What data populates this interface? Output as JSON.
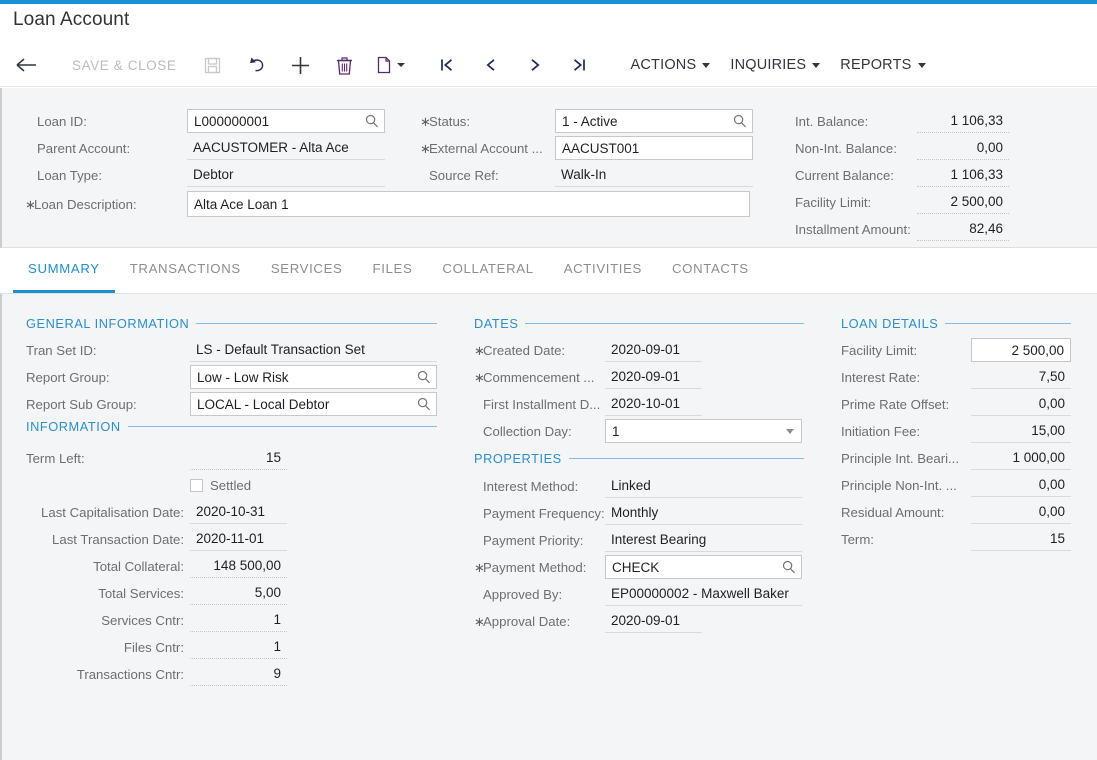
{
  "window": {
    "title": "Loan Account",
    "accent_color": "#1b90d4"
  },
  "toolbar": {
    "back_icon": "back-arrow-icon",
    "save_close_label": "SAVE & CLOSE",
    "save_icon": "save-icon",
    "undo_icon": "undo-icon",
    "add_icon": "plus-icon",
    "delete_icon": "trash-icon",
    "copy_icon": "copy-paste-icon",
    "first_icon": "first-record-icon",
    "prev_icon": "previous-record-icon",
    "next_icon": "next-record-icon",
    "last_icon": "last-record-icon",
    "menus": [
      {
        "label": "ACTIONS"
      },
      {
        "label": "INQUIRIES"
      },
      {
        "label": "REPORTS"
      }
    ]
  },
  "header": {
    "left_fields": [
      {
        "label": "Loan ID:",
        "value": "L000000001",
        "required": false,
        "style": "input",
        "lookup": true
      },
      {
        "label": "Parent Account:",
        "value": "AACUSTOMER - Alta Ace",
        "required": false,
        "style": "readonly",
        "lookup": false
      },
      {
        "label": "Loan Type:",
        "value": "Debtor",
        "required": false,
        "style": "readonly",
        "lookup": false
      }
    ],
    "description_field": {
      "label": "Loan Description:",
      "value": "Alta Ace Loan 1",
      "required": true
    },
    "mid_fields": [
      {
        "label": "Status:",
        "value": "1 - Active",
        "required": true,
        "style": "input",
        "lookup": true
      },
      {
        "label": "External Account ...",
        "value": "AACUST001",
        "required": true,
        "style": "input",
        "lookup": false
      },
      {
        "label": "Source Ref:",
        "value": "Walk-In",
        "required": false,
        "style": "readonly",
        "lookup": false
      }
    ],
    "balances": [
      {
        "label": "Int. Balance:",
        "value": "1 106,33"
      },
      {
        "label": "Non-Int. Balance:",
        "value": "0,00"
      },
      {
        "label": "Current Balance:",
        "value": "1 106,33"
      },
      {
        "label": "Facility Limit:",
        "value": "2 500,00"
      },
      {
        "label": "Installment Amount:",
        "value": "82,46"
      }
    ]
  },
  "tabs": [
    {
      "label": "SUMMARY",
      "active": true
    },
    {
      "label": "TRANSACTIONS",
      "active": false
    },
    {
      "label": "SERVICES",
      "active": false
    },
    {
      "label": "FILES",
      "active": false
    },
    {
      "label": "COLLATERAL",
      "active": false
    },
    {
      "label": "ACTIVITIES",
      "active": false
    },
    {
      "label": "CONTACTS",
      "active": false
    }
  ],
  "sections": {
    "general_information": {
      "title": "GENERAL INFORMATION",
      "fields": [
        {
          "label": "Tran Set ID:",
          "value": "LS - Default Transaction Set",
          "style": "readonly",
          "lookup": false,
          "required": false
        },
        {
          "label": "Report Group:",
          "value": "Low - Low Risk",
          "style": "input",
          "lookup": true,
          "required": false
        },
        {
          "label": "Report Sub Group:",
          "value": "LOCAL - Local Debtor",
          "style": "input",
          "lookup": true,
          "required": false
        }
      ]
    },
    "information": {
      "title": "INFORMATION",
      "term_left": {
        "label": "Term Left:",
        "value": "15"
      },
      "settled": {
        "label": "Settled",
        "checked": false
      },
      "fields": [
        {
          "label": "Last Capitalisation Date:",
          "value": "2020-10-31",
          "align": "left",
          "style": "readonly"
        },
        {
          "label": "Last Transaction Date:",
          "value": "2020-11-01",
          "align": "left",
          "style": "readonly"
        },
        {
          "label": "Total Collateral:",
          "value": "148 500,00",
          "align": "right",
          "style": "dotted"
        },
        {
          "label": "Total Services:",
          "value": "5,00",
          "align": "right",
          "style": "dotted"
        },
        {
          "label": "Services Cntr:",
          "value": "1",
          "align": "right",
          "style": "dotted"
        },
        {
          "label": "Files Cntr:",
          "value": "1",
          "align": "right",
          "style": "dotted"
        },
        {
          "label": "Transactions Cntr:",
          "value": "9",
          "align": "right",
          "style": "dotted"
        }
      ]
    },
    "dates": {
      "title": "DATES",
      "fields": [
        {
          "label": "Created Date:",
          "value": "2020-09-01",
          "required": true,
          "style": "readonly"
        },
        {
          "label": "Commencement ...",
          "value": "2020-09-01",
          "required": true,
          "style": "readonly"
        },
        {
          "label": "First Installment D...",
          "value": "2020-10-01",
          "required": false,
          "style": "readonly"
        }
      ],
      "collection_day": {
        "label": "Collection Day:",
        "value": "1",
        "required": false
      }
    },
    "properties": {
      "title": "PROPERTIES",
      "fields": [
        {
          "label": "Interest Method:",
          "value": "Linked",
          "required": false,
          "style": "readonly",
          "lookup": false
        },
        {
          "label": "Payment Frequency:",
          "value": "Monthly",
          "required": false,
          "style": "readonly",
          "lookup": false
        },
        {
          "label": "Payment Priority:",
          "value": "Interest Bearing",
          "required": false,
          "style": "readonly",
          "lookup": false
        },
        {
          "label": "Payment Method:",
          "value": "CHECK",
          "required": true,
          "style": "input",
          "lookup": true
        },
        {
          "label": "Approved By:",
          "value": "EP00000002 - Maxwell Baker",
          "required": false,
          "style": "readonly",
          "lookup": false
        },
        {
          "label": "Approval Date:",
          "value": "2020-09-01",
          "required": true,
          "style": "readonly",
          "lookup": false
        }
      ]
    },
    "loan_details": {
      "title": "LOAN DETAILS",
      "fields": [
        {
          "label": "Facility Limit:",
          "value": "2 500,00",
          "style": "input"
        },
        {
          "label": "Interest Rate:",
          "value": "7,50",
          "style": "readonly"
        },
        {
          "label": "Prime Rate Offset:",
          "value": "0,00",
          "style": "readonly"
        },
        {
          "label": "Initiation Fee:",
          "value": "15,00",
          "style": "readonly"
        },
        {
          "label": "Principle Int. Beari...",
          "value": "1 000,00",
          "style": "readonly"
        },
        {
          "label": "Principle Non-Int. ...",
          "value": "0,00",
          "style": "readonly"
        },
        {
          "label": "Residual Amount:",
          "value": "0,00",
          "style": "readonly"
        },
        {
          "label": "Term:",
          "value": "15",
          "style": "readonly"
        }
      ]
    }
  }
}
